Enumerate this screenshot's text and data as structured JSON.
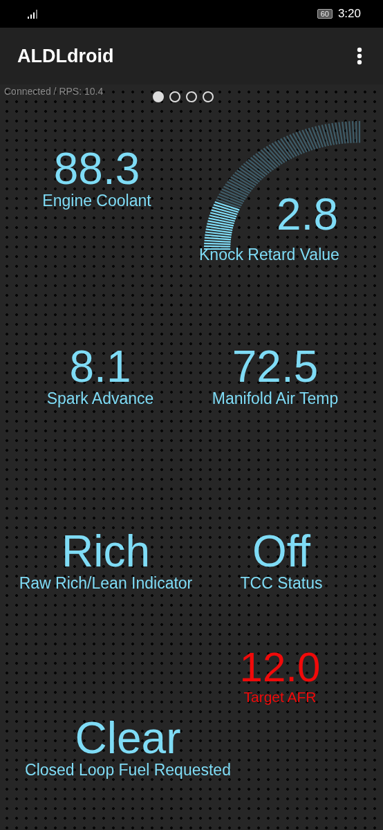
{
  "status_bar": {
    "battery": "60",
    "time": "3:20"
  },
  "app_bar": {
    "title": "ALDLdroid"
  },
  "connection": "Connected / RPS: 10.4",
  "pages": [
    {
      "selected": true
    },
    {
      "selected": false
    },
    {
      "selected": false
    },
    {
      "selected": false
    }
  ],
  "gauges": [
    {
      "kind": "readout",
      "value": "88.3",
      "label": "Engine Coolant",
      "warning": false
    },
    {
      "kind": "arc",
      "value": "2.8",
      "label": "Knock Retard Value",
      "warning": false
    },
    {
      "kind": "readout",
      "value": "8.1",
      "label": "Spark Advance",
      "warning": false
    },
    {
      "kind": "readout",
      "value": "72.5",
      "label": "Manifold Air Temp",
      "warning": false
    },
    {
      "kind": "readout",
      "value": "Rich",
      "label": "Raw Rich/Lean Indicator",
      "warning": false
    },
    {
      "kind": "readout",
      "value": "Off",
      "label": "TCC Status",
      "warning": false
    },
    {
      "kind": "readout",
      "value": "12.0",
      "label": "Target AFR",
      "warning": true
    },
    {
      "kind": "readout",
      "value": "Clear",
      "label": "Closed Loop Fuel Requested",
      "warning": false
    }
  ]
}
